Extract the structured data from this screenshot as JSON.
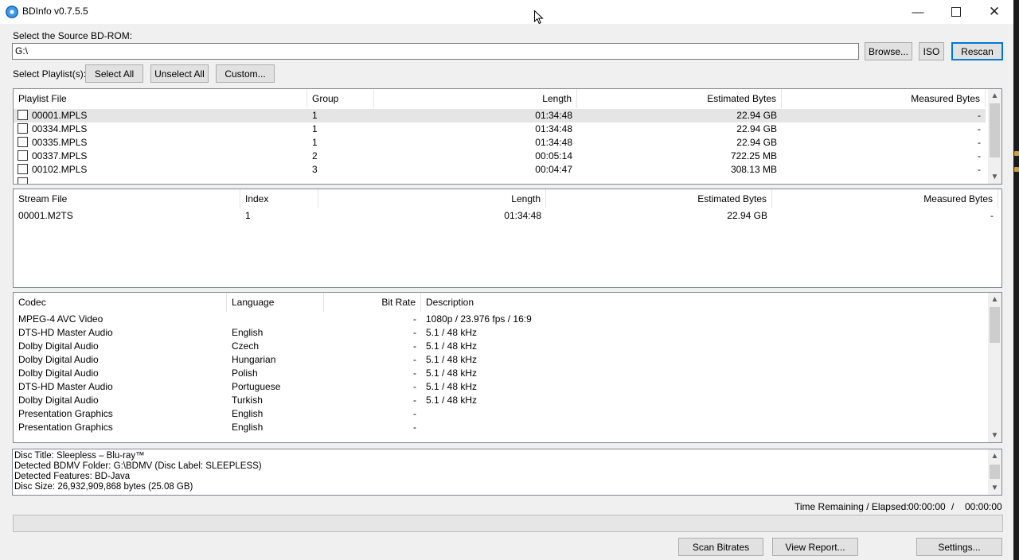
{
  "window": {
    "title": "BDInfo v0.7.5.5"
  },
  "source": {
    "label": "Select the Source BD-ROM:",
    "path": "G:\\",
    "browse_label": "Browse...",
    "iso_label": "ISO",
    "rescan_label": "Rescan"
  },
  "playlist_select": {
    "label": "Select Playlist(s):",
    "select_all_label": "Select All",
    "unselect_all_label": "Unselect All",
    "custom_label": "Custom..."
  },
  "playlists": {
    "headers": [
      "Playlist File",
      "Group",
      "Length",
      "Estimated Bytes",
      "Measured Bytes"
    ],
    "rows": [
      {
        "file": "00001.MPLS",
        "group": "1",
        "length": "01:34:48",
        "estimated": "22.94 GB",
        "measured": "-"
      },
      {
        "file": "00334.MPLS",
        "group": "1",
        "length": "01:34:48",
        "estimated": "22.94 GB",
        "measured": "-"
      },
      {
        "file": "00335.MPLS",
        "group": "1",
        "length": "01:34:48",
        "estimated": "22.94 GB",
        "measured": "-"
      },
      {
        "file": "00337.MPLS",
        "group": "2",
        "length": "00:05:14",
        "estimated": "722.25 MB",
        "measured": "-"
      },
      {
        "file": "00102.MPLS",
        "group": "3",
        "length": "00:04:47",
        "estimated": "308.13 MB",
        "measured": "-"
      }
    ]
  },
  "streams": {
    "headers": [
      "Stream File",
      "Index",
      "Length",
      "Estimated Bytes",
      "Measured Bytes"
    ],
    "rows": [
      {
        "file": "00001.M2TS",
        "index": "1",
        "length": "01:34:48",
        "estimated": "22.94 GB",
        "measured": "-"
      }
    ]
  },
  "codecs": {
    "headers": [
      "Codec",
      "Language",
      "Bit Rate",
      "Description"
    ],
    "rows": [
      {
        "codec": "MPEG-4 AVC Video",
        "language": "",
        "bitrate": "-",
        "description": "1080p / 23.976 fps / 16:9"
      },
      {
        "codec": "DTS-HD Master Audio",
        "language": "English",
        "bitrate": "-",
        "description": "5.1 / 48 kHz"
      },
      {
        "codec": "Dolby Digital Audio",
        "language": "Czech",
        "bitrate": "-",
        "description": "5.1 / 48 kHz"
      },
      {
        "codec": "Dolby Digital Audio",
        "language": "Hungarian",
        "bitrate": "-",
        "description": "5.1 / 48 kHz"
      },
      {
        "codec": "Dolby Digital Audio",
        "language": "Polish",
        "bitrate": "-",
        "description": "5.1 / 48 kHz"
      },
      {
        "codec": "DTS-HD Master Audio",
        "language": "Portuguese",
        "bitrate": "-",
        "description": "5.1 / 48 kHz"
      },
      {
        "codec": "Dolby Digital Audio",
        "language": "Turkish",
        "bitrate": "-",
        "description": "5.1 / 48 kHz"
      },
      {
        "codec": "Presentation Graphics",
        "language": "English",
        "bitrate": "-",
        "description": ""
      },
      {
        "codec": "Presentation Graphics",
        "language": "English",
        "bitrate": "-",
        "description": ""
      }
    ]
  },
  "disc_info": {
    "lines": [
      "Disc Title: Sleepless – Blu-ray™",
      "Detected BDMV Folder: G:\\BDMV (Disc Label: SLEEPLESS)",
      "Detected Features: BD-Java",
      "Disc Size: 26,932,909,868 bytes (25.08 GB)"
    ]
  },
  "status": {
    "time_label": "Time Remaining / Elapsed:",
    "remaining": "00:00:00",
    "separator": "/",
    "elapsed": "00:00:00",
    "progress": 0
  },
  "actions": {
    "scan_label": "Scan Bitrates",
    "report_label": "View Report...",
    "settings_label": "Settings..."
  },
  "colors": {
    "accent": "#0078d7",
    "selected_row": "#e5e5e5",
    "progress_fill": "#06b025"
  }
}
